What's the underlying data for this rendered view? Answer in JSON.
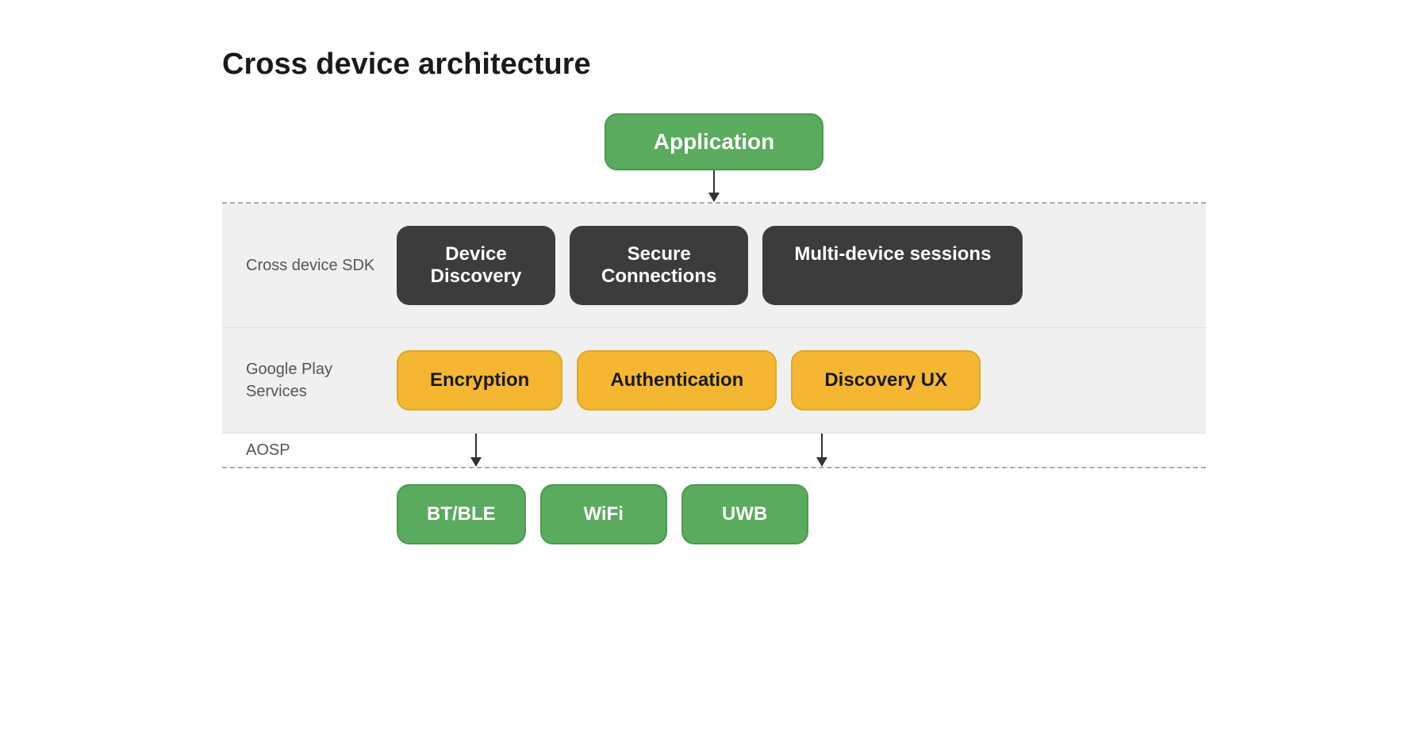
{
  "title": "Cross device architecture",
  "application": {
    "label": "Application"
  },
  "sdk_band": {
    "label": "Cross device SDK",
    "items": [
      {
        "text": "Device\nDiscovery"
      },
      {
        "text": "Secure\nConnections"
      },
      {
        "text": "Multi-device sessions"
      }
    ]
  },
  "play_services_band": {
    "label": "Google Play\nServices",
    "items": [
      {
        "text": "Encryption"
      },
      {
        "text": "Authentication"
      },
      {
        "text": "Discovery UX"
      }
    ]
  },
  "aosp": {
    "label": "AOSP"
  },
  "bottom_boxes": [
    {
      "text": "BT/BLE"
    },
    {
      "text": "WiFi"
    },
    {
      "text": "UWB"
    }
  ]
}
